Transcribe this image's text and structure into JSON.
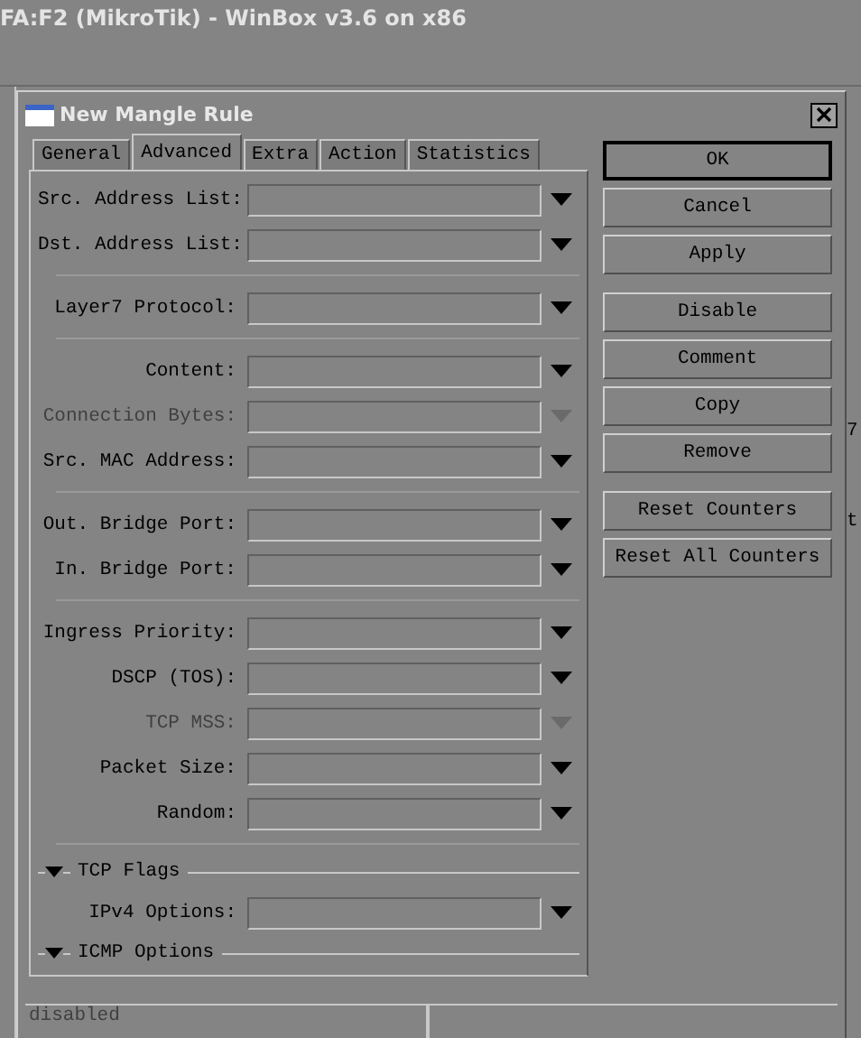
{
  "app_title": "FA:F2 (MikroTik) - WinBox v3.6 on x86",
  "dialog": {
    "title": "New Mangle Rule"
  },
  "tabs": [
    {
      "label": "General",
      "selected": false
    },
    {
      "label": "Advanced",
      "selected": true
    },
    {
      "label": "Extra",
      "selected": false
    },
    {
      "label": "Action",
      "selected": false
    },
    {
      "label": "Statistics",
      "selected": false
    }
  ],
  "rows": [
    {
      "kind": "field",
      "label": "Src. Address List:",
      "disabled": false
    },
    {
      "kind": "field",
      "label": "Dst. Address List:",
      "disabled": false
    },
    {
      "kind": "divider"
    },
    {
      "kind": "field",
      "label": "Layer7 Protocol:",
      "disabled": false
    },
    {
      "kind": "divider"
    },
    {
      "kind": "field",
      "label": "Content:",
      "disabled": false
    },
    {
      "kind": "field",
      "label": "Connection Bytes:",
      "disabled": true
    },
    {
      "kind": "field",
      "label": "Src. MAC Address:",
      "disabled": false
    },
    {
      "kind": "divider"
    },
    {
      "kind": "field",
      "label": "Out. Bridge Port:",
      "disabled": false
    },
    {
      "kind": "field",
      "label": "In. Bridge Port:",
      "disabled": false
    },
    {
      "kind": "divider"
    },
    {
      "kind": "field",
      "label": "Ingress Priority:",
      "disabled": false
    },
    {
      "kind": "field",
      "label": "DSCP (TOS):",
      "disabled": false
    },
    {
      "kind": "field",
      "label": "TCP MSS:",
      "disabled": true
    },
    {
      "kind": "field",
      "label": "Packet Size:",
      "disabled": false
    },
    {
      "kind": "field",
      "label": "Random:",
      "disabled": false
    },
    {
      "kind": "divider"
    },
    {
      "kind": "section",
      "label": "TCP Flags"
    },
    {
      "kind": "field",
      "label": "IPv4 Options:",
      "disabled": false
    },
    {
      "kind": "section",
      "label": "ICMP Options"
    }
  ],
  "button_groups": [
    {
      "buttons": [
        {
          "label": "OK",
          "default": true
        },
        {
          "label": "Cancel",
          "default": false
        },
        {
          "label": "Apply",
          "default": false
        }
      ]
    },
    {
      "buttons": [
        {
          "label": "Disable",
          "default": false
        },
        {
          "label": "Comment",
          "default": false
        },
        {
          "label": "Copy",
          "default": false
        },
        {
          "label": "Remove",
          "default": false
        }
      ]
    },
    {
      "buttons": [
        {
          "label": "Reset Counters",
          "default": false
        },
        {
          "label": "Reset All Counters",
          "default": false
        }
      ]
    }
  ],
  "status_bar": {
    "text": "disabled"
  },
  "background_fragments": [
    "7",
    "t"
  ]
}
